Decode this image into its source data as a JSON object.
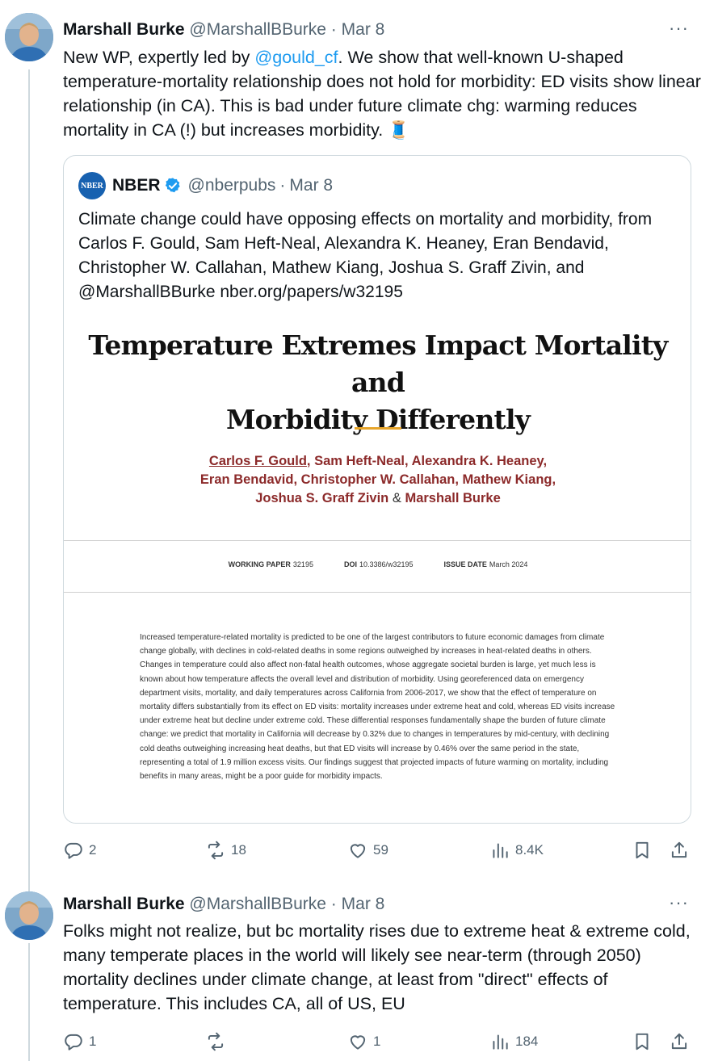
{
  "tweet1": {
    "author_name": "Marshall Burke",
    "handle": "@MarshallBBurke",
    "separator": "·",
    "date": "Mar 8",
    "more": "···",
    "text_before_mention": "New WP, expertly led by ",
    "mention": "@gould_cf",
    "text_after_mention": ". We show that well-known U-shaped temperature-mortality relationship does not hold for morbidity:  ED visits show linear relationship (in CA).  This is bad under future climate chg: warming reduces mortality in CA (!) but increases morbidity. 🧵",
    "quote": {
      "logo_text": "NBER",
      "author_name": "NBER",
      "handle": "@nberpubs",
      "separator": "·",
      "date": "Mar 8",
      "text": "Climate change could have opposing effects on mortality and morbidity, from Carlos F. Gould, Sam Heft-Neal, Alexandra K. Heaney, Eran Bendavid, Christopher W. Callahan, Mathew Kiang, Joshua S. Graff Zivin, and @MarshallBBurke nber.org/papers/w32195",
      "paper": {
        "title_line1": "Temperature Extremes Impact Mortality and",
        "title_line2": "Morbidity Differently",
        "authors_line1": [
          "Carlos F. Gould",
          "Sam Heft-Neal",
          "Alexandra K. Heaney"
        ],
        "authors_line2": [
          "Eran Bendavid",
          "Christopher W. Callahan",
          "Mathew Kiang"
        ],
        "authors_line3_a": "Joshua S. Graff Zivin",
        "amp": "&",
        "authors_line3_b": "Marshall Burke",
        "comma": ",",
        "working_paper_label": "WORKING PAPER",
        "working_paper_value": "32195",
        "doi_label": "DOI",
        "doi_value": "10.3386/w32195",
        "issue_date_label": "ISSUE DATE",
        "issue_date_value": "March 2024",
        "abstract": "Increased temperature-related mortality is predicted to be one of the largest contributors to future economic damages from climate change globally, with declines in cold-related deaths in some regions outweighed by increases in heat-related deaths in others. Changes in temperature could also affect non-fatal health outcomes, whose aggregate societal burden is large, yet much less is known about how temperature affects the overall level and distribution of morbidity. Using georeferenced data on emergency department visits, mortality, and daily temperatures across California from 2006-2017, we show that the effect of temperature on mortality differs substantially from its effect on ED visits: mortality increases under extreme heat and cold, whereas ED visits increase under extreme heat but decline under extreme cold. These differential responses fundamentally shape the burden of future climate change: we predict that mortality in California will decrease by 0.32% due to changes in temperatures by mid-century, with declining cold deaths outweighing increasing heat deaths, but that ED visits will increase by 0.46% over the same period in the state, representing a total of 1.9 million excess visits. Our findings suggest that projected impacts of future warming on mortality, including benefits in many areas, might be a poor guide for morbidity impacts."
      }
    },
    "actions": {
      "replies": "2",
      "reposts": "18",
      "likes": "59",
      "views": "8.4K"
    }
  },
  "tweet2": {
    "author_name": "Marshall Burke",
    "handle": "@MarshallBBurke",
    "separator": "·",
    "date": "Mar 8",
    "more": "···",
    "text": "Folks might not realize, but bc mortality rises due to extreme heat & extreme cold, many temperate places in the world will likely see near-term (through 2050) mortality declines under climate change, at least from \"direct\" effects of temperature.  This includes CA, all of US, EU",
    "actions": {
      "replies": "1",
      "reposts": "",
      "likes": "1",
      "views": "184"
    }
  },
  "icons": {
    "reply": "reply-icon",
    "repost": "repost-icon",
    "like": "heart-icon",
    "views": "views-chart-icon",
    "bookmark": "bookmark-icon",
    "share": "share-icon",
    "verified": "verified-badge-icon"
  },
  "colors": {
    "link": "#1d9bf0",
    "secondary_text": "#536471",
    "border": "#cfd9de",
    "paper_author": "#8c2a2a",
    "gold_accent": "#e7a52a",
    "nber_blue": "#1761b0"
  }
}
